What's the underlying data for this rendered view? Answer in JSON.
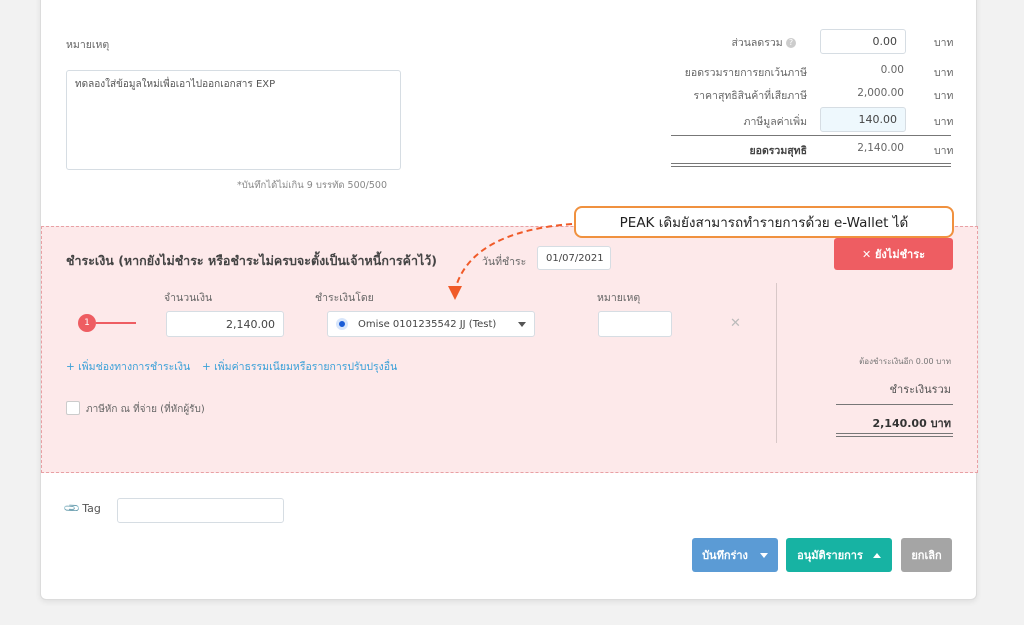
{
  "remarks": {
    "label": "หมายเหตุ",
    "text": "ทดลองใส่ข้อมูลใหม่เพื่อเอาไปออกเอกสาร EXP",
    "hint": "*บันทึกได้ไม่เกิน 9 บรรทัด 500/500"
  },
  "summary": {
    "discount_label": "ส่วนลดรวม",
    "discount_value": "0.00",
    "nontax_label": "ยอดรวมรายการยกเว้นภาษี",
    "nontax_value": "0.00",
    "taxable_label": "ราคาสุทธิสินค้าที่เสียภาษี",
    "taxable_value": "2,000.00",
    "vat_label": "ภาษีมูลค่าเพิ่ม",
    "vat_value": "140.00",
    "total_label": "ยอดรวมสุทธิ",
    "total_value": "2,140.00",
    "currency": "บาท"
  },
  "callout": "PEAK เดิมยังสามารถทำรายการด้วย e-Wallet ได้",
  "payment": {
    "title": "ชำระเงิน (หากยังไม่ชำระ หรือชำระไม่ครบจะตั้งเป็นเจ้าหนี้การค้าไว้)",
    "date_label": "วันที่ชำระ",
    "date_value": "01/07/2021",
    "unpaid_button": "✕ ยังไม่ชำระ",
    "amount_header": "จำนวนเงิน",
    "method_header": "ชำระเงินโดย",
    "note_header": "หมายเหตุ",
    "step_badge": "1",
    "amount_value": "2,140.00",
    "method_value": "Omise 0101235542 JJ (Test)",
    "add_channel_link": "+ เพิ่มช่องทางการชำระเงิน",
    "add_fee_link": "+ เพิ่มค่าธรรมเนียมหรือรายการปรับปรุงอื่น",
    "withholding_label": "ภาษีหัก ณ ที่จ่าย (ที่หักผู้รับ)",
    "remaining_text": "ต้องชำระเงินอีก 0.00 บาท",
    "paid_total_label": "ชำระเงินรวม",
    "paid_total_value": "2,140.00",
    "paid_total_currency": "บาท"
  },
  "tag": {
    "label": "Tag",
    "placeholder": ""
  },
  "actions": {
    "draft_label": "บันทึกร่าง",
    "approve_label": "อนุมัติรายการ",
    "cancel_label": "ยกเลิก"
  },
  "colors": {
    "accent": "#17b3a3",
    "draft": "#5b9bd5",
    "danger": "#ee5d62",
    "callout": "#f0913f",
    "arrow": "#f05a28"
  },
  "icons": {
    "info": "info-icon",
    "paperclip": "tag-icon",
    "remove": "close-icon",
    "dropdown": "caret-down-icon"
  }
}
